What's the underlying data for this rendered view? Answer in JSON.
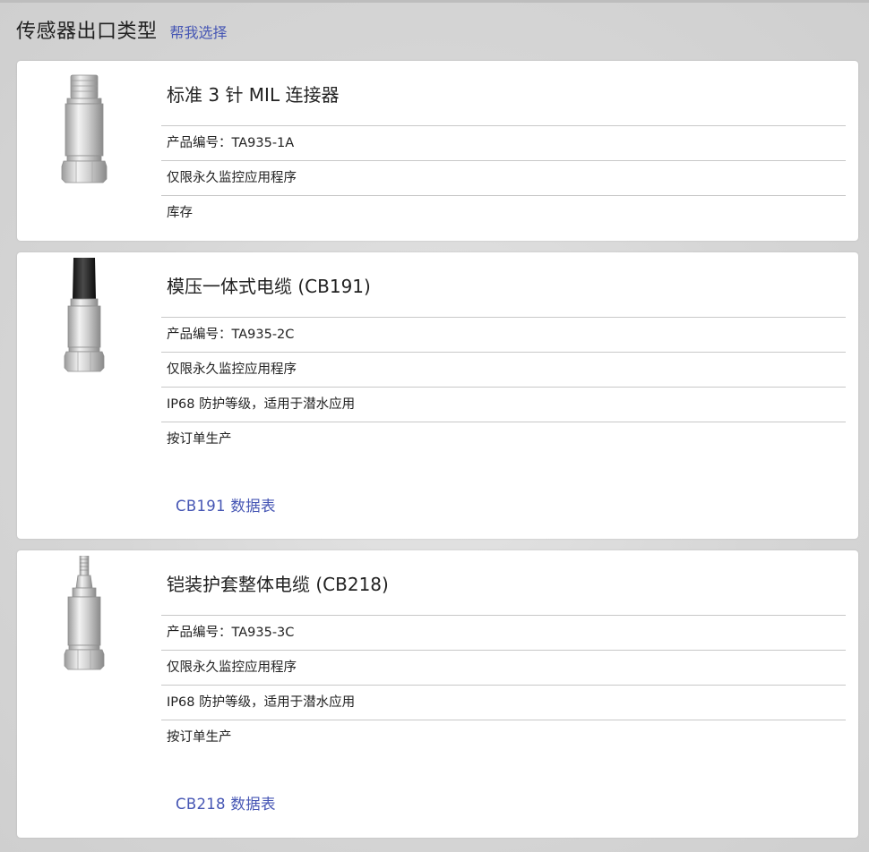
{
  "header": {
    "title": "传感器出口类型",
    "help_link": "帮我选择"
  },
  "products": [
    {
      "title": "标准 3 针 MIL 连接器",
      "specs": [
        "产品编号：TA935-1A",
        "仅限永久监控应用程序",
        "库存"
      ],
      "image": "sensor-mil-connector-icon"
    },
    {
      "title": "模压一体式电缆 (CB191)",
      "specs": [
        "产品编号：TA935-2C",
        "仅限永久监控应用程序",
        "IP68 防护等级，适用于潜水应用",
        "按订单生产"
      ],
      "datasheet": "CB191 数据表",
      "image": "sensor-molded-cable-icon"
    },
    {
      "title": "铠装护套整体电缆 (CB218)",
      "specs": [
        "产品编号：TA935-3C",
        "仅限永久监控应用程序",
        "IP68 防护等级，适用于潜水应用",
        "按订单生产"
      ],
      "datasheet": "CB218 数据表",
      "image": "sensor-armored-cable-icon"
    }
  ]
}
